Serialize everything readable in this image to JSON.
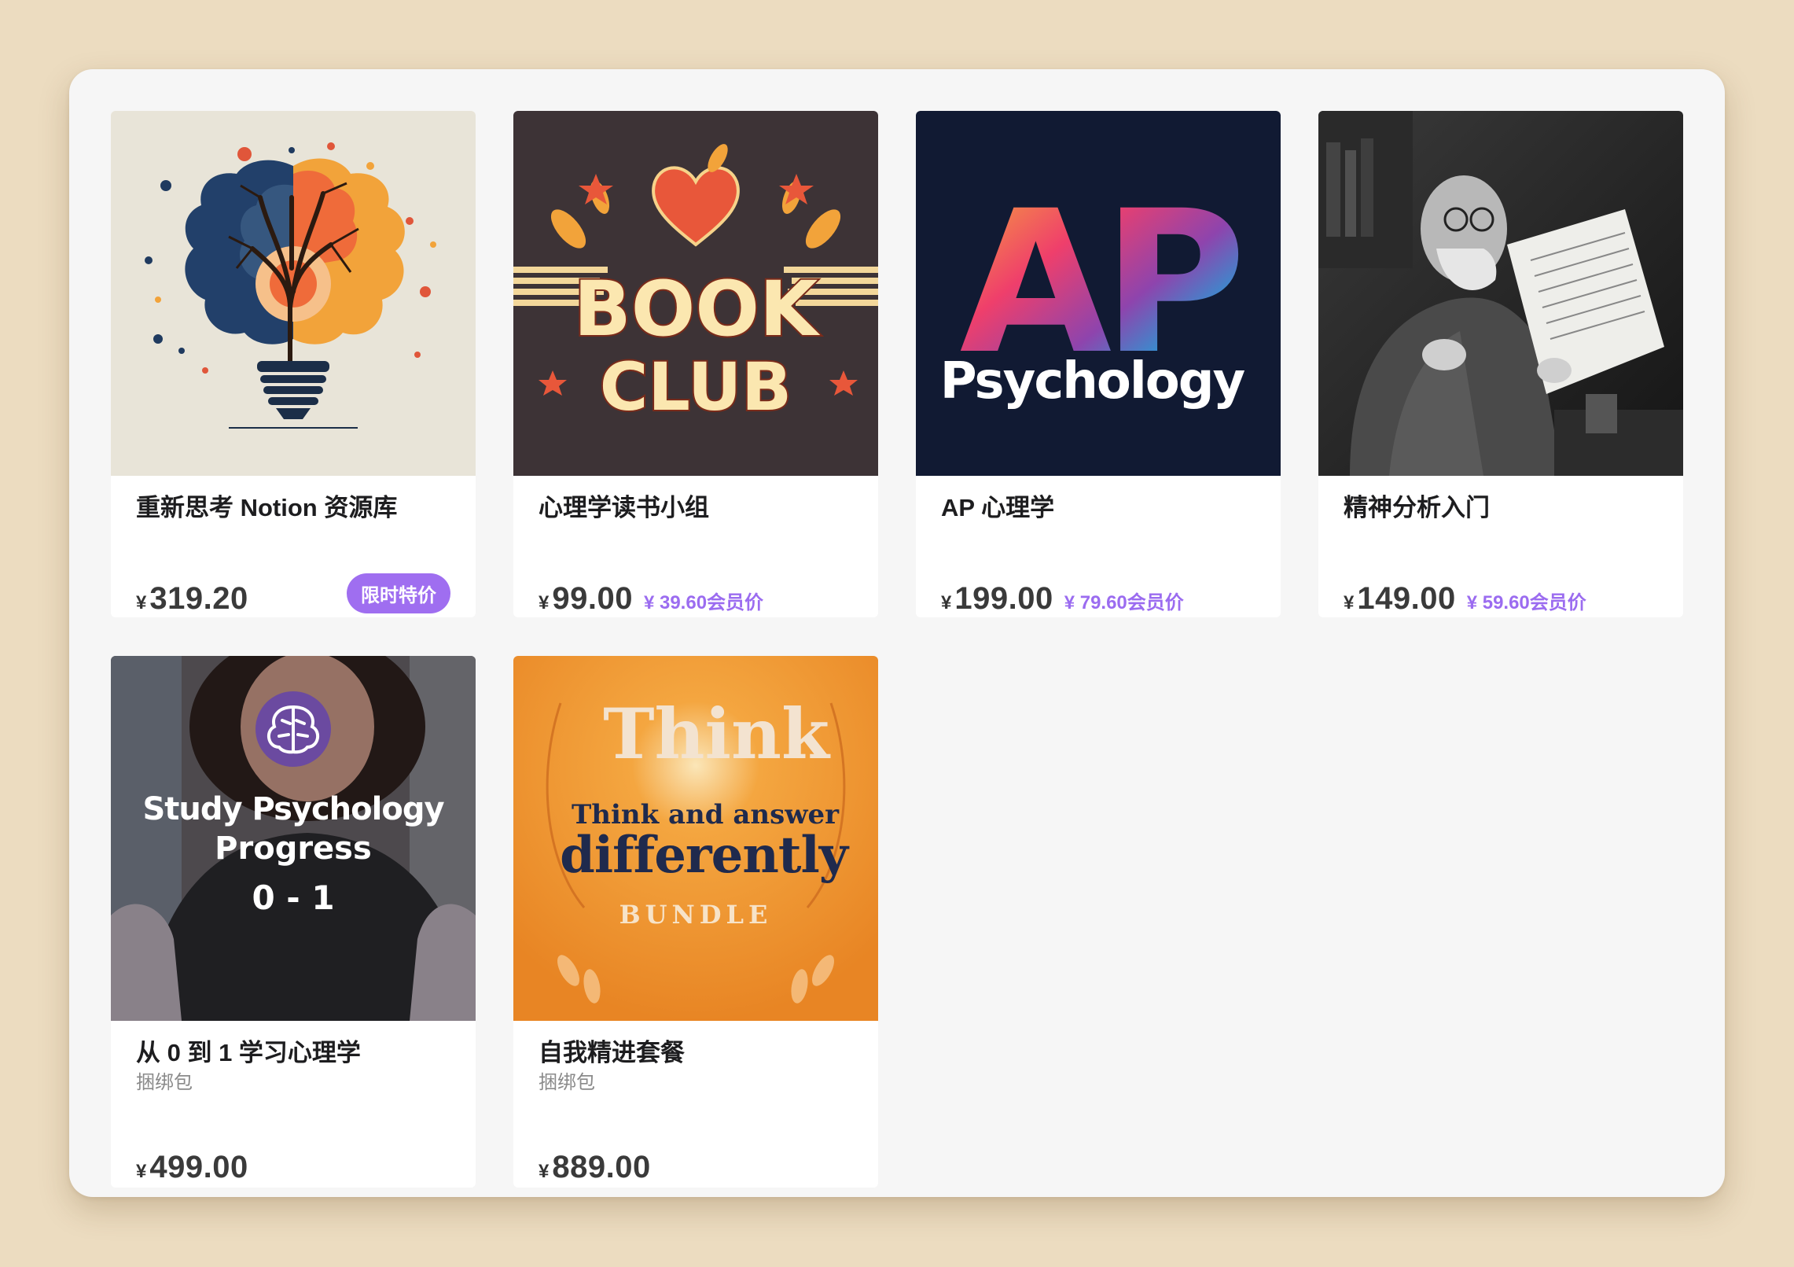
{
  "products": [
    {
      "title": "重新思考 Notion 资源库",
      "currency": "¥",
      "price": "319.20",
      "badge": "限时特价"
    },
    {
      "title": "心理学读书小组",
      "currency": "¥",
      "price": "99.00",
      "member_price": "¥ 39.60会员价"
    },
    {
      "title": "AP 心理学",
      "currency": "¥",
      "price": "199.00",
      "member_price": "¥ 79.60会员价"
    },
    {
      "title": "精神分析入门",
      "currency": "¥",
      "price": "149.00",
      "member_price": "¥ 59.60会员价"
    },
    {
      "title": "从 0 到 1 学习心理学",
      "subtitle": "捆绑包",
      "currency": "¥",
      "price": "499.00"
    },
    {
      "title": "自我精进套餐",
      "subtitle": "捆绑包",
      "currency": "¥",
      "price": "889.00"
    }
  ],
  "covers": {
    "book_club": {
      "line1": "BOOK",
      "line2": "CLUB"
    },
    "ap_psych": {
      "big": "AP",
      "word": "Psychology"
    },
    "study": {
      "line1": "Study Psychology",
      "line2": "Progress",
      "line3": "0 - 1"
    },
    "think": {
      "big": "Think",
      "line2": "Think and answer",
      "line3": "differently",
      "line4": "BUNDLE"
    }
  },
  "colors": {
    "background": "#ecdcc0",
    "accent": "#9f6ef0",
    "member_price": "#9b6cf0"
  }
}
